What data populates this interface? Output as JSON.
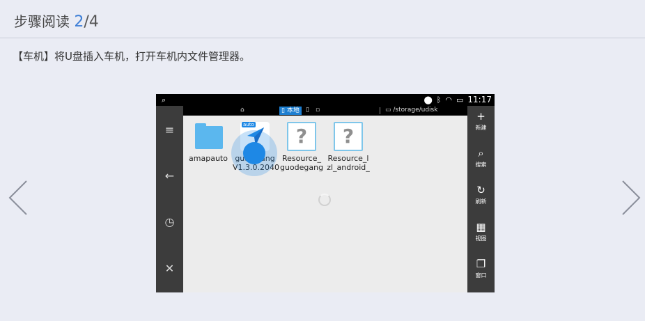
{
  "header": {
    "title": "步骤阅读",
    "step_current": "2",
    "step_separator": "/",
    "step_total": "4"
  },
  "instruction": "【车机】将U盘插入车机，打开车机内文件管理器。",
  "device": {
    "status_bar": {
      "time": "11:17"
    },
    "path_bar": {
      "local_label": "本地",
      "path": "/storage/udisk"
    },
    "right_toolbar": [
      {
        "icon": "plus-icon",
        "glyph": "+",
        "label": "新建"
      },
      {
        "icon": "search-icon",
        "glyph": "⌕",
        "label": "搜索"
      },
      {
        "icon": "refresh-icon",
        "glyph": "↻",
        "label": "刷新"
      },
      {
        "icon": "grid-icon",
        "glyph": "▦",
        "label": "视图"
      },
      {
        "icon": "window-icon",
        "glyph": "❐",
        "label": "窗口"
      }
    ],
    "left_toolbar": [
      {
        "icon": "menu-icon",
        "glyph": "≡"
      },
      {
        "icon": "back-arrow-icon",
        "glyph": "←"
      },
      {
        "icon": "clock-icon",
        "glyph": "◷"
      },
      {
        "icon": "close-icon",
        "glyph": "✕"
      }
    ],
    "files": [
      {
        "type": "folder",
        "name_line1": "amapauto",
        "name_line2": ""
      },
      {
        "type": "app",
        "badge": "auto",
        "name_line1": "guanwang",
        "name_line2": "V1.3.0.2040"
      },
      {
        "type": "unknown",
        "name_line1": "Resource_",
        "name_line2": "guodegang"
      },
      {
        "type": "unknown",
        "name_line1": "Resource_l",
        "name_line2": "zl_android_"
      }
    ]
  },
  "colors": {
    "accent": "#3d7ed6",
    "device_bar": "#3c3c3c",
    "folder": "#5bb7ee",
    "highlight": "#1e88e5"
  }
}
